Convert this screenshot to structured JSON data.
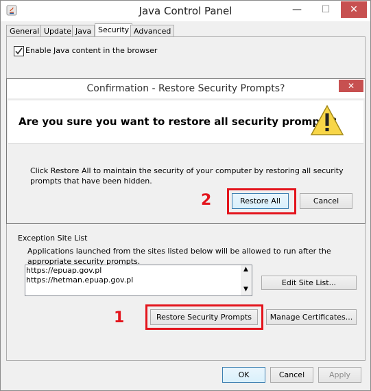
{
  "window": {
    "title": "Java Control Panel",
    "minimize": "—",
    "maximize": "☐",
    "close": "✕"
  },
  "tabs": [
    "General",
    "Update",
    "Java",
    "Security",
    "Advanced"
  ],
  "active_tab": "Security",
  "security": {
    "enable_checkbox_label": "Enable Java content in the browser",
    "enable_checked": true,
    "exception_title": "Exception Site List",
    "exception_desc": "Applications launched from the sites listed below will be allowed to run after the appropriate security prompts.",
    "sites": [
      "https://epuap.gov.pl",
      "https://hetman.epuap.gov.pl"
    ],
    "edit_site_list": "Edit Site List...",
    "restore_prompts": "Restore Security Prompts",
    "manage_certs": "Manage Certificates..."
  },
  "dialog": {
    "title": "Confirmation - Restore Security Prompts?",
    "close": "✕",
    "question": "Are you sure you want to restore all security prompts?",
    "message": "Click Restore All to maintain the security of your computer by restoring all security prompts that have been hidden.",
    "restore_all": "Restore All",
    "cancel": "Cancel"
  },
  "annotations": {
    "one": "1",
    "two": "2"
  },
  "footer": {
    "ok": "OK",
    "cancel": "Cancel",
    "apply": "Apply"
  },
  "colors": {
    "highlight": "#e3141c"
  }
}
